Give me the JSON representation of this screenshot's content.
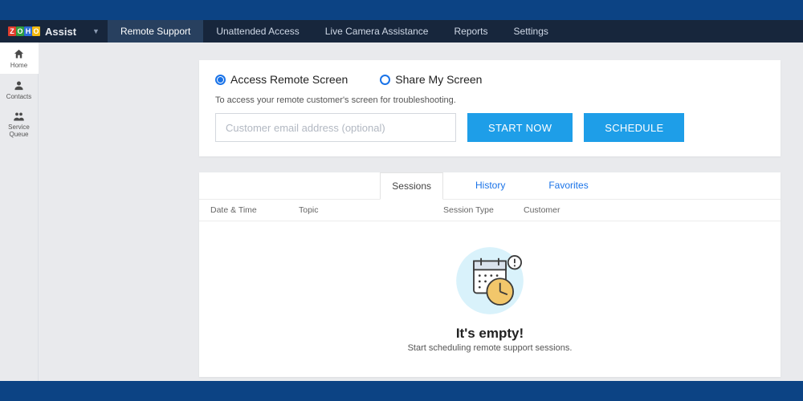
{
  "brand": {
    "name": "Assist"
  },
  "nav": {
    "items": [
      "Remote Support",
      "Unattended Access",
      "Live Camera Assistance",
      "Reports",
      "Settings"
    ],
    "active": 0
  },
  "sidebar": {
    "items": [
      {
        "label": "Home",
        "icon": "home"
      },
      {
        "label": "Contacts",
        "icon": "user"
      },
      {
        "label": "Service Queue",
        "icon": "queue"
      }
    ],
    "selected": 0
  },
  "session_modes": {
    "options": [
      {
        "label": "Access Remote Screen",
        "checked": true
      },
      {
        "label": "Share My Screen",
        "checked": false
      }
    ],
    "helper": "To access your remote customer's screen for troubleshooting.",
    "email_placeholder": "Customer email address (optional)",
    "start_btn": "START NOW",
    "schedule_btn": "SCHEDULE"
  },
  "list": {
    "tabs": [
      "Sessions",
      "History",
      "Favorites"
    ],
    "active_tab": 0,
    "columns": [
      "Date & Time",
      "Topic",
      "Session Type",
      "Customer"
    ],
    "empty_title": "It's empty!",
    "empty_sub": "Start scheduling remote support sessions."
  }
}
